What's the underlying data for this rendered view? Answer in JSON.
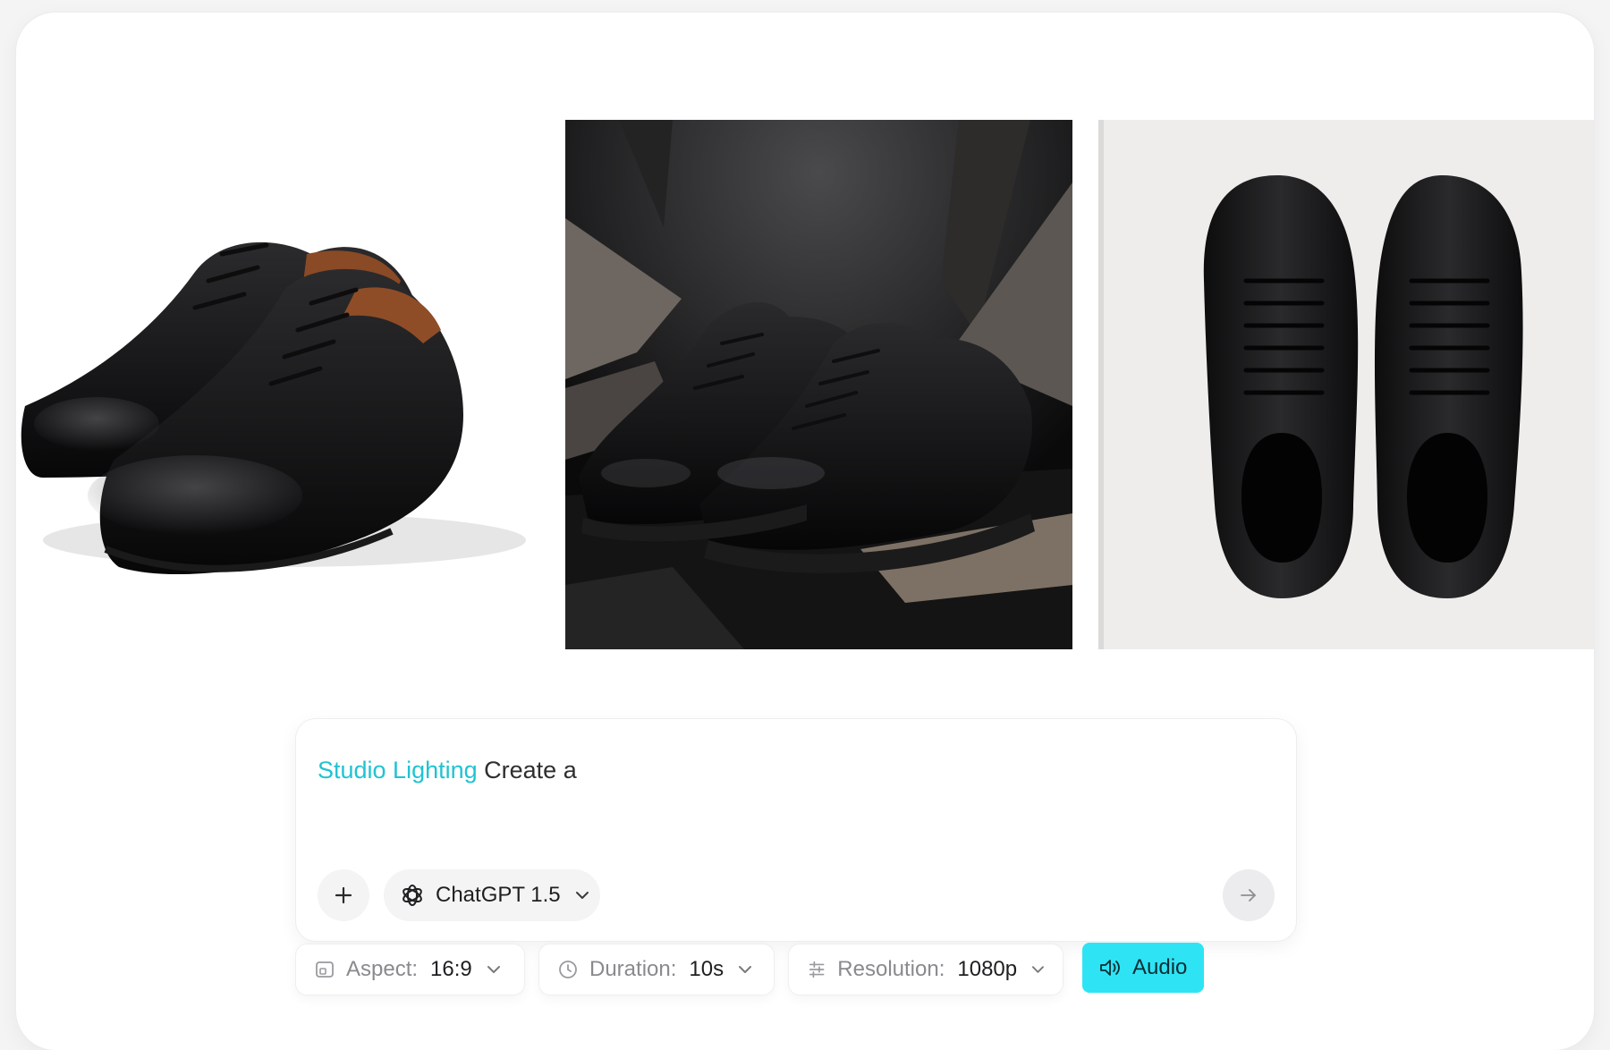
{
  "gallery": {
    "images": [
      {
        "subject": "black leather cap-toe oxford shoes on white background"
      },
      {
        "subject": "black leather sneakers on dark geometric studio set"
      },
      {
        "subject": "top-down view of black leather sneakers on light background"
      }
    ]
  },
  "composer": {
    "prompt_tag": "Studio Lighting",
    "prompt_text": "Create a",
    "model_label": "ChatGPT 1.5"
  },
  "settings": {
    "aspect_label": "Aspect:",
    "aspect_value": "16:9",
    "duration_label": "Duration:",
    "duration_value": "10s",
    "resolution_label": "Resolution:",
    "resolution_value": "1080p",
    "audio_label": "Audio"
  },
  "colors": {
    "accent_text": "#1fc3d3",
    "audio_bg": "#2ee4f4",
    "card_bg": "#ffffff",
    "page_bg": "#f4f4f5"
  },
  "icons": {
    "plus": "plus-icon",
    "model": "openai-logo-icon",
    "chevron": "chevron-down-icon",
    "send": "arrow-right-icon",
    "aspect": "aspect-ratio-icon",
    "duration": "clock-icon",
    "resolution": "sliders-icon",
    "audio": "speaker-icon"
  }
}
